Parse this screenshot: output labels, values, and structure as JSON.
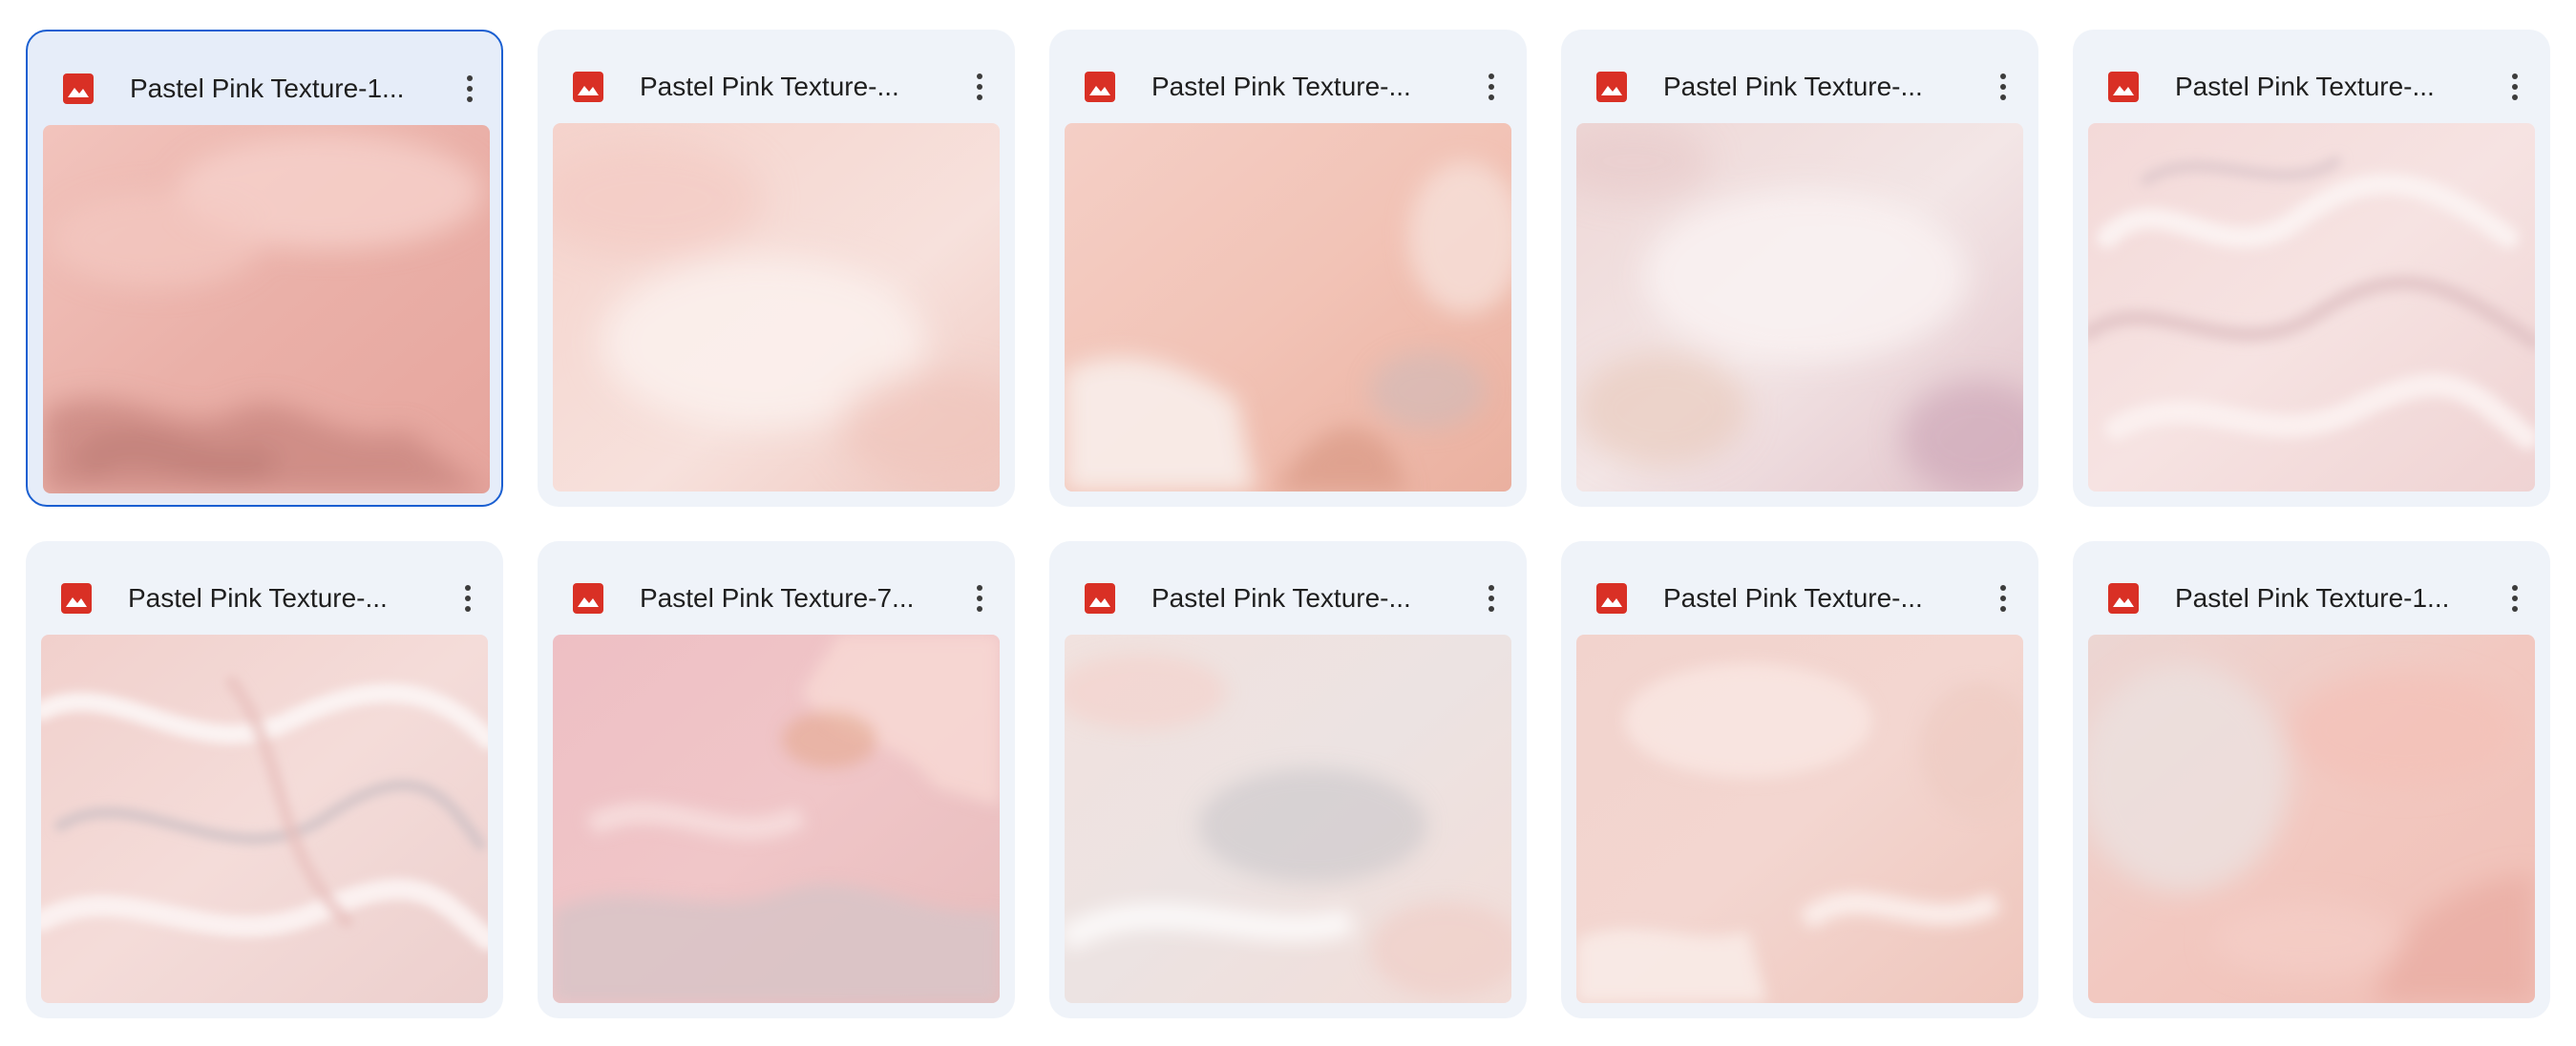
{
  "files": [
    {
      "title": "Pastel Pink Texture-1...",
      "selected": true
    },
    {
      "title": "Pastel Pink Texture-...",
      "selected": false
    },
    {
      "title": "Pastel Pink Texture-...",
      "selected": false
    },
    {
      "title": "Pastel Pink Texture-...",
      "selected": false
    },
    {
      "title": "Pastel Pink Texture-...",
      "selected": false
    },
    {
      "title": "Pastel Pink Texture-...",
      "selected": false
    },
    {
      "title": "Pastel Pink Texture-7...",
      "selected": false
    },
    {
      "title": "Pastel Pink Texture-...",
      "selected": false
    },
    {
      "title": "Pastel Pink Texture-...",
      "selected": false
    },
    {
      "title": "Pastel Pink Texture-1...",
      "selected": false
    }
  ],
  "icons": {
    "file_type": "image-file-icon",
    "menu": "more-vert-icon"
  },
  "colors": {
    "image_icon": "#d93025",
    "selection_border": "#1a5fd1",
    "card_bg": "#eff3f9"
  }
}
